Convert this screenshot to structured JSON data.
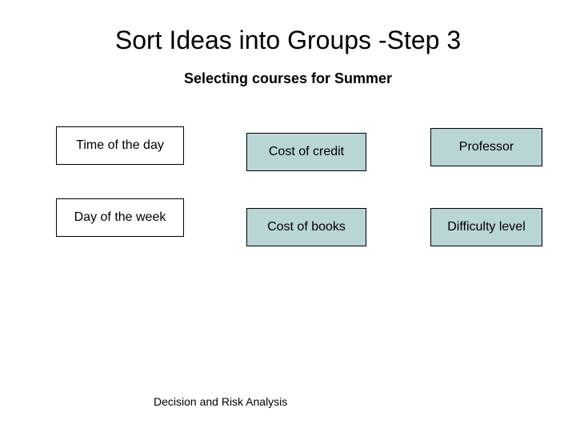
{
  "title": "Sort Ideas into Groups -Step 3",
  "subtitle": "Selecting courses for Summer",
  "boxes": {
    "time_of_day": "Time of the day",
    "day_of_week": "Day of the week",
    "cost_of_credit": "Cost of credit",
    "cost_of_books": "Cost of books",
    "professor": "Professor",
    "difficulty_level": "Difficulty level"
  },
  "footer": "Decision and Risk Analysis"
}
